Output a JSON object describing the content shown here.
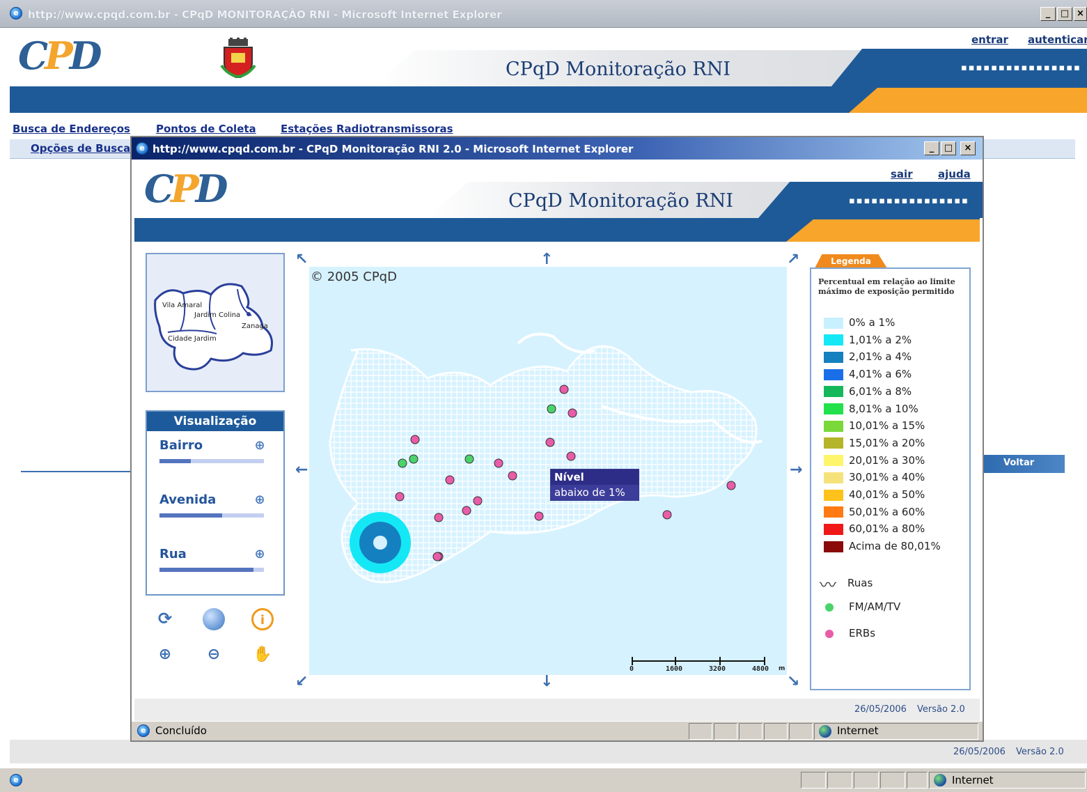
{
  "outer_window": {
    "title": "http://www.cpqd.com.br - CPqD MONITORAÇÃO RNI - Microsoft Internet Explorer",
    "links": {
      "login": "entrar",
      "authenticate": "autenticar"
    },
    "logo_text": "CPqD",
    "banner_title": "CPqD Monitoração RNI",
    "dots": "▪▪▪▪▪▪▪▪▪▪▪▪▪▪▪▪",
    "nav": [
      "Busca de Endereços",
      "Pontos de Coleta",
      "Estações Radiotransmissoras"
    ],
    "subnav": "Opções de Busca",
    "back_button": "Voltar",
    "footer": {
      "date": "26/05/2006",
      "version": "Versão 2.0"
    },
    "status": {
      "zone": "Internet"
    }
  },
  "popup": {
    "title": "http://www.cpqd.com.br - CPqD Monitoração RNI 2.0 - Microsoft Internet Explorer",
    "links": {
      "logout": "sair",
      "help": "ajuda"
    },
    "logo_text": "CPqD",
    "banner_title": "CPqD Monitoração RNI",
    "dots": "▪▪▪▪▪▪▪▪▪▪▪▪▪▪▪▪",
    "overview_map": {
      "labels": [
        "Vila Amaral",
        "Jardim Colina",
        "Zanaga",
        "Cidade Jardim"
      ]
    },
    "visualizacao": {
      "header": "Visualização",
      "items": [
        {
          "label": "Bairro",
          "scale": "-▪▪▪▪▪▪▪▪▪+",
          "level": 0.3
        },
        {
          "label": "Avenida",
          "scale": "-▪▪▪▪▪▪▪▪▪+",
          "level": 0.6
        },
        {
          "label": "Rua",
          "scale": "-▪▪▪▪▪▪▪▪▪+",
          "level": 0.9
        }
      ]
    },
    "map": {
      "copyright": "© 2005 CPqD",
      "scale_labels": [
        "0",
        "1600",
        "3200",
        "4800"
      ],
      "scale_unit": "m",
      "tooltip": {
        "title": "Nível",
        "value": "abaixo de 1%"
      }
    },
    "legend": {
      "tab": "Legenda",
      "description": "Percentual em relação ao limite máximo de exposição permitido",
      "items": [
        {
          "label": "0% a 1%",
          "color": "#c8f0ff"
        },
        {
          "label": "1,01% a 2%",
          "color": "#14e8f5"
        },
        {
          "label": "2,01% a 4%",
          "color": "#1580c0"
        },
        {
          "label": "4,01% a 6%",
          "color": "#1a6fe8"
        },
        {
          "label": "6,01% a 8%",
          "color": "#14b85a"
        },
        {
          "label": "8,01% a 10%",
          "color": "#22e14a"
        },
        {
          "label": "10,01% a 15%",
          "color": "#7ad83a"
        },
        {
          "label": "15,01% a 20%",
          "color": "#b5b52a"
        },
        {
          "label": "20,01% a 30%",
          "color": "#fff56a"
        },
        {
          "label": "30,01% a 40%",
          "color": "#f5e27a"
        },
        {
          "label": "40,01% a 50%",
          "color": "#ffc21a"
        },
        {
          "label": "50,01% a 60%",
          "color": "#ff7a12"
        },
        {
          "label": "60,01% a 80%",
          "color": "#f01818"
        },
        {
          "label": "Acima de 80,01%",
          "color": "#8a0a0a"
        }
      ],
      "layers": [
        "Ruas",
        "FM/AM/TV",
        "ERBs"
      ]
    },
    "footer": {
      "date": "26/05/2006",
      "version": "Versão 2.0"
    },
    "status": {
      "text": "Concluído",
      "zone": "Internet"
    }
  }
}
